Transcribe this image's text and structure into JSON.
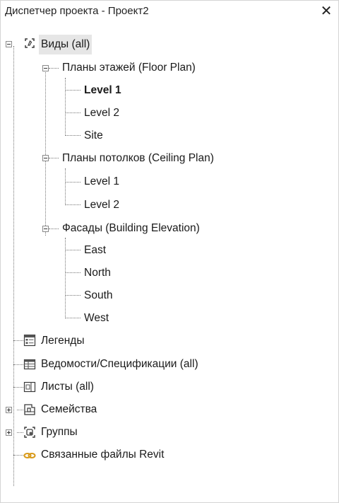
{
  "window": {
    "title": "Диспетчер проекта - Проект2",
    "close_glyph": "✕"
  },
  "tree": {
    "views": {
      "label": "Виды (all)",
      "floor_plans": {
        "label": "Планы этажей (Floor Plan)",
        "items": [
          "Level 1",
          "Level 2",
          "Site"
        ]
      },
      "ceiling_plans": {
        "label": "Планы потолков (Ceiling Plan)",
        "items": [
          "Level 1",
          "Level 2"
        ]
      },
      "elevations": {
        "label": "Фасады (Building Elevation)",
        "items": [
          "East",
          "North",
          "South",
          "West"
        ]
      }
    },
    "legends": "Легенды",
    "schedules": "Ведомости/Спецификации (all)",
    "sheets": "Листы (all)",
    "families": "Семейства",
    "groups": "Группы",
    "revit_links": "Связанные файлы Revit"
  },
  "icons": {
    "views": "views-icon",
    "legends": "legend-icon",
    "schedules": "schedule-icon",
    "sheets": "sheet-icon",
    "families": "family-icon",
    "groups": "group-icon",
    "links": "link-icon"
  },
  "colors": {
    "link_icon": "#d89a1a",
    "selection": "#e6e6e6"
  }
}
